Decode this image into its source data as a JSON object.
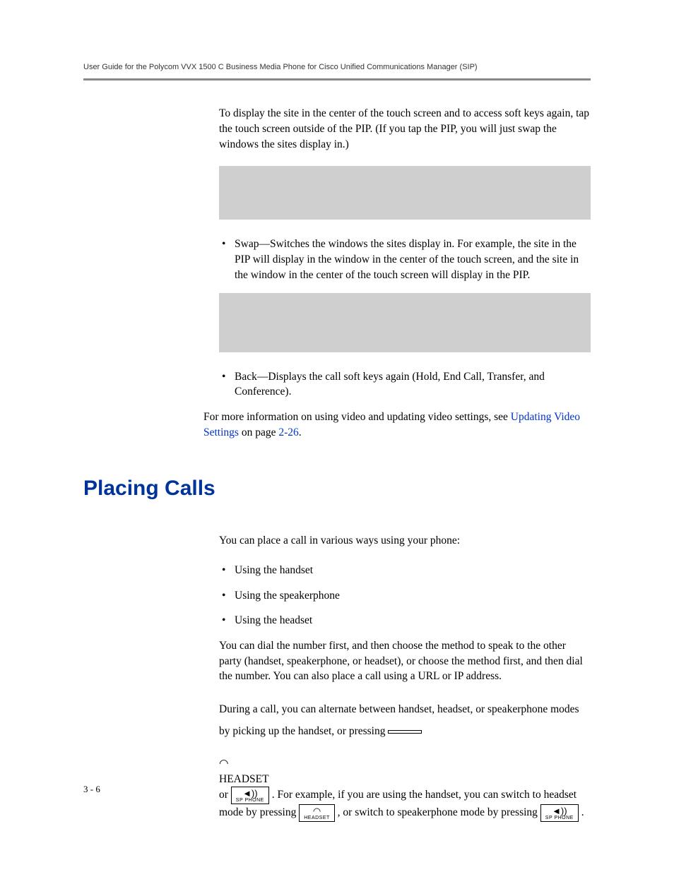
{
  "header": {
    "running_head": "User Guide for the Polycom VVX 1500 C Business Media Phone for Cisco Unified Communications Manager (SIP)"
  },
  "body": {
    "para1": "To display the site in the center of the touch screen and to access soft keys again, tap the touch screen outside of the PIP. (If you tap the PIP, you will just swap the windows the sites display in.)",
    "bullet_swap": "Swap—Switches the windows the sites display in. For example, the site in the PIP will display in the window in the center of the touch screen, and the site in the window in the center of the touch screen will display in the PIP.",
    "bullet_back": "Back—Displays the call soft keys again (Hold, End Call, Transfer, and Conference).",
    "para_moreinfo_pre": "For more information on using video and updating video settings, see ",
    "para_moreinfo_link": "Updating Video Settings",
    "para_moreinfo_mid": " on page ",
    "para_moreinfo_pageref": "2-26",
    "para_moreinfo_post": "."
  },
  "section": {
    "heading": "Placing Calls",
    "intro": "You can place a call in various ways using your phone:",
    "methods": [
      "Using the handset",
      "Using the speakerphone",
      "Using the headset"
    ],
    "dialfirst": "You can dial the number first, and then choose the method to speak to the other party (handset, speakerphone, or headset), or choose the method first, and then dial the number. You can also place a call using a URL or IP address.",
    "alt_line1": "During a call, you can alternate between handset, headset, or speakerphone ",
    "alt_line2a": "modes by picking up the handset, or pressing ",
    "alt_line2b": " or ",
    "alt_line2c": ". For ",
    "alt_line3": "example, if you are using the handset, you can switch to headset mode by ",
    "alt_line4a": "pressing ",
    "alt_line4b": ", or switch to speakerphone mode by pressing ",
    "alt_line4c": "."
  },
  "keys": {
    "headset_icon": "◠",
    "headset_label": "HEADSET",
    "spphone_icon": "◄))",
    "spphone_label": "SP PHONE"
  },
  "footer": {
    "page": "3 - 6"
  }
}
